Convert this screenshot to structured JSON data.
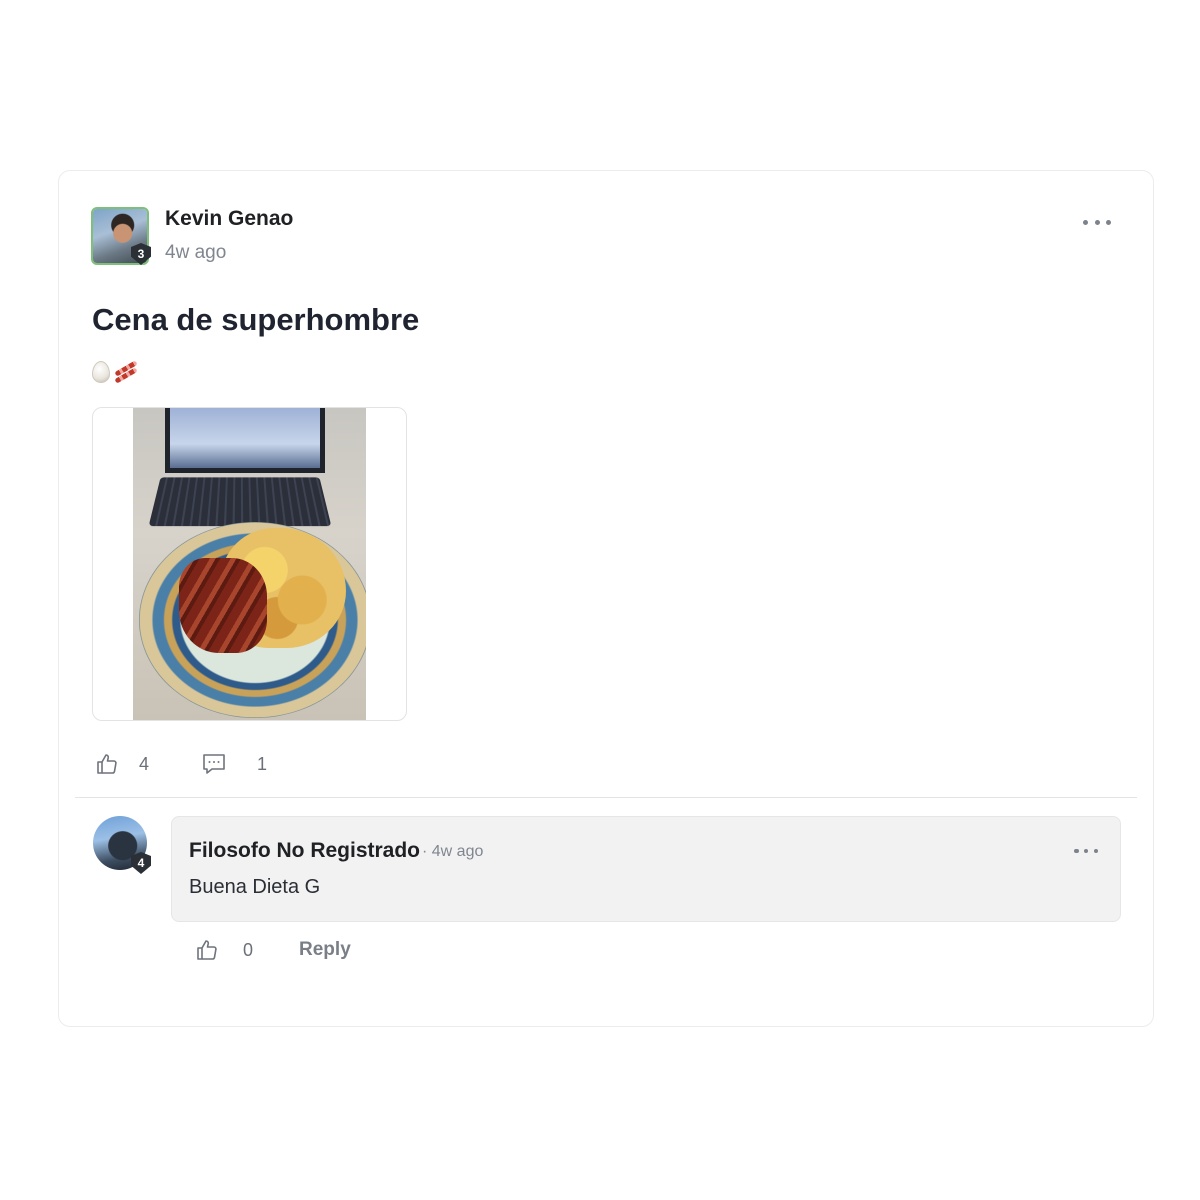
{
  "post": {
    "author": "Kevin Genao",
    "author_level": "3",
    "time": "4w ago",
    "title": "Cena de superhombre",
    "emojis": [
      "egg-emoji",
      "bacon-emoji"
    ],
    "attachment_icon": "photo-of-bacon-and-eggs",
    "likes": "4",
    "comments": "1",
    "avatar_border_color": "#7ec07a"
  },
  "comment": {
    "author": "Filosofo No Registrado",
    "author_level": "4",
    "time": "· 4w ago",
    "text": "Buena Dieta G",
    "likes": "0",
    "reply_label": "Reply"
  }
}
